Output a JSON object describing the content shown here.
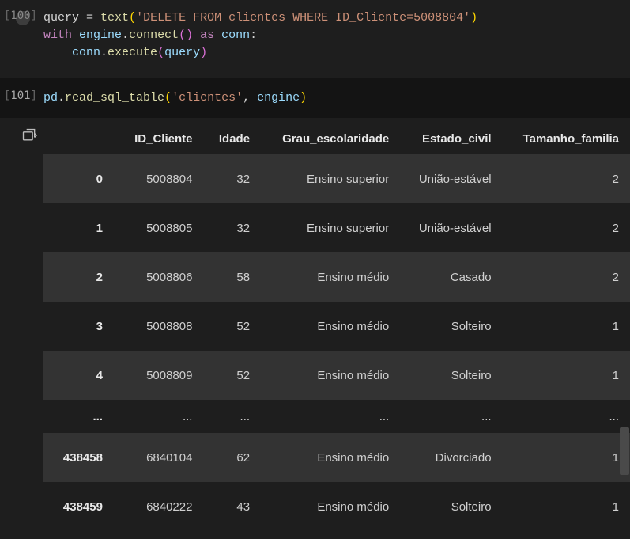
{
  "cells": {
    "c100": {
      "prompt_num": "100",
      "code": {
        "line1": {
          "p1": "query ",
          "eq": "= ",
          "fn": "text",
          "lp": "(",
          "str": "'DELETE FROM clientes WHERE ID_Cliente=5008804'",
          "rp": ")"
        },
        "line2": {
          "kw1": "with",
          "sp1": " ",
          "v1": "engine",
          "dot1": ".",
          "fn1": "connect",
          "lp1": "(",
          "rp1": ")",
          "sp2": " ",
          "kw2": "as",
          "sp3": " ",
          "v2": "conn",
          "colon": ":"
        },
        "line3": {
          "indent": "    ",
          "v1": "conn",
          "dot": ".",
          "fn": "execute",
          "lp": "(",
          "arg": "query",
          "rp": ")"
        }
      }
    },
    "c101": {
      "prompt_num": "101",
      "code": {
        "line1": {
          "v1": "pd",
          "dot": ".",
          "fn": "read_sql_table",
          "lp": "(",
          "str": "'clientes'",
          "comma": ", ",
          "arg": "engine",
          "rp": ")"
        }
      }
    }
  },
  "chart_data": {
    "type": "table",
    "columns": [
      "ID_Cliente",
      "Idade",
      "Grau_escolaridade",
      "Estado_civil",
      "Tamanho_familia"
    ],
    "index": [
      "0",
      "1",
      "2",
      "3",
      "4",
      "...",
      "438458",
      "438459"
    ],
    "rows": [
      [
        "5008804",
        "32",
        "Ensino superior",
        "União-estável",
        "2"
      ],
      [
        "5008805",
        "32",
        "Ensino superior",
        "União-estável",
        "2"
      ],
      [
        "5008806",
        "58",
        "Ensino médio",
        "Casado",
        "2"
      ],
      [
        "5008808",
        "52",
        "Ensino médio",
        "Solteiro",
        "1"
      ],
      [
        "5008809",
        "52",
        "Ensino médio",
        "Solteiro",
        "1"
      ],
      [
        "...",
        "...",
        "...",
        "...",
        "..."
      ],
      [
        "6840104",
        "62",
        "Ensino médio",
        "Divorciado",
        "1"
      ],
      [
        "6840222",
        "43",
        "Ensino médio",
        "Solteiro",
        "1"
      ]
    ]
  }
}
